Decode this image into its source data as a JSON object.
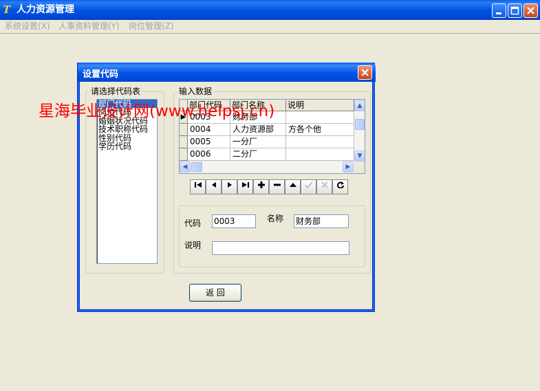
{
  "window": {
    "title": "人力资源管理"
  },
  "menu": [
    {
      "label": "系统设置(X)"
    },
    {
      "label": "人事资料管理(Y)"
    },
    {
      "label": "岗位管理(Z)"
    }
  ],
  "dialog": {
    "title": "设置代码",
    "list_group_label": "请选择代码表",
    "list_items": [
      "部门代码",
      "岗位代码",
      "婚姻状况代码",
      "技术职称代码",
      "性别代码",
      "学历代码"
    ],
    "selected_item": "部门代码",
    "input_group_label": "输入数据",
    "grid": {
      "columns": [
        "部门代码",
        "部门名称",
        "说明"
      ],
      "rows": [
        {
          "indicator": "▶",
          "code": "0003",
          "name": "财务部",
          "note": ""
        },
        {
          "indicator": "",
          "code": "0004",
          "name": "人力资源部",
          "note": "方各个他"
        },
        {
          "indicator": "",
          "code": "0005",
          "name": "一分厂",
          "note": ""
        },
        {
          "indicator": "",
          "code": "0006",
          "name": "二分厂",
          "note": ""
        }
      ]
    },
    "form": {
      "code_label": "代码",
      "code_value": "0003",
      "name_label": "名称",
      "name_value": "财务部",
      "note_label": "说明",
      "note_value": ""
    },
    "return_button": "返 回"
  },
  "watermark": "星海毕业设计网(www.helpsj.cn)"
}
